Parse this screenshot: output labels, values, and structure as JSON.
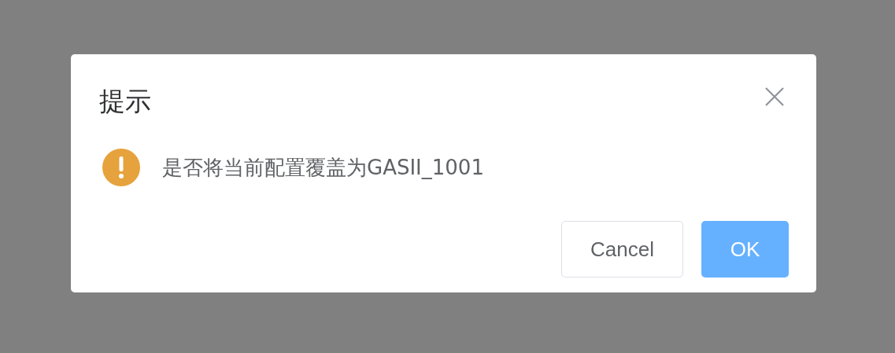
{
  "dialog": {
    "title": "提示",
    "message": "是否将当前配置覆盖为GASII_1001",
    "buttons": [
      {
        "label": "Cancel",
        "kind": "default"
      },
      {
        "label": "OK",
        "kind": "primary"
      }
    ]
  }
}
